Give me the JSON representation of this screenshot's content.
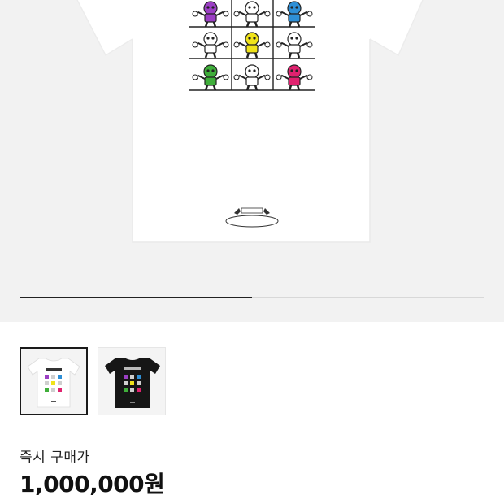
{
  "product": {
    "image_alt": "white t-shirt with 3x3 grid of colorful skeleton figures print",
    "gallery_progress": 0.5
  },
  "thumbnails": [
    {
      "name": "white-shirt",
      "selected": true
    },
    {
      "name": "black-shirt",
      "selected": false
    }
  ],
  "price": {
    "label": "즉시 구매가",
    "value": "1,000,000원"
  },
  "colors": {
    "hero_bg": "#f2f2f2",
    "progress_fill": "#222222",
    "figure_purple": "#9b3fc4",
    "figure_blue": "#2e8fd6",
    "figure_yellow": "#f0e31a",
    "figure_green": "#3fae3a",
    "figure_pink": "#e0226f"
  }
}
